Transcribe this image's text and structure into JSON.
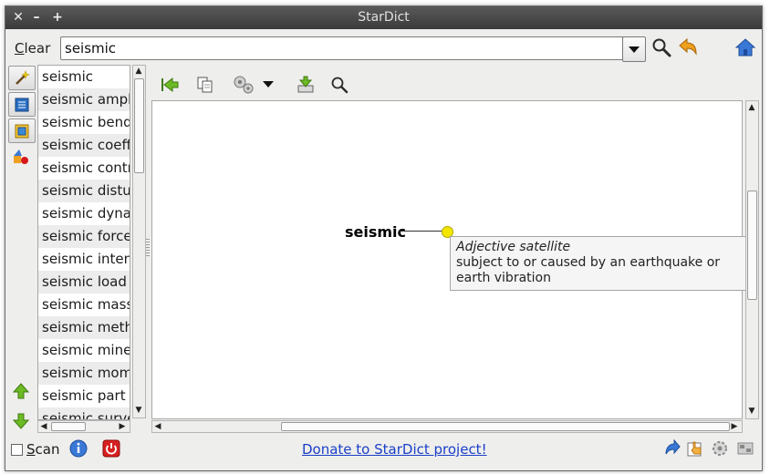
{
  "window": {
    "title": "StarDict"
  },
  "titlebar": {
    "close": "✕",
    "minimize": "–",
    "maximize": "+"
  },
  "search": {
    "clear_label": "C",
    "clear_label_rest": "lear",
    "query": "seismic"
  },
  "word_list": [
    "seismic",
    "seismic amplit",
    "seismic bendi",
    "seismic coeffi",
    "seismic contra",
    "seismic distur",
    "seismic dynam",
    "seismic force",
    "seismic intens",
    "seismic load",
    "seismic mass",
    "seismic metho",
    "seismic miner",
    "seismic mome",
    "seismic part (a",
    "seismic surve"
  ],
  "definition": {
    "headword": "seismic",
    "pos": "Adjective satellite",
    "gloss": "subject to or caused by an earthquake or earth vibration"
  },
  "status": {
    "scan_label": "S",
    "scan_label_rest": "can",
    "donate_text": "Donate to StarDict project!"
  },
  "colors": {
    "accent_green": "#5aa81e",
    "link_blue": "#1a3fc8",
    "tooltip_dot": "#f2e600"
  }
}
